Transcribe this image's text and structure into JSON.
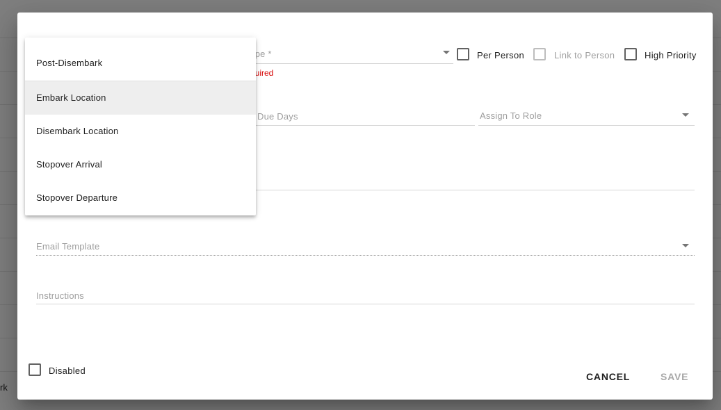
{
  "background": {
    "partial_text": "rk"
  },
  "dialog": {
    "type_field": {
      "label": "ype *",
      "error": "quired"
    },
    "checkboxes": {
      "per_person": "Per Person",
      "link_to_person": "Link to Person",
      "high_priority": "High Priority"
    },
    "due_days": {
      "label": "Due Days"
    },
    "assign_to_role": {
      "label": "Assign To Role"
    },
    "email_template": {
      "label": "Email Template"
    },
    "instructions": {
      "label": "Instructions"
    },
    "disabled_checkbox": {
      "label": "Disabled"
    },
    "actions": {
      "cancel": "CANCEL",
      "save": "SAVE"
    },
    "dropdown": {
      "items": [
        {
          "label": "Post-Disembark"
        },
        {
          "label": "Embark Location"
        },
        {
          "label": "Disembark Location"
        },
        {
          "label": "Stopover Arrival"
        },
        {
          "label": "Stopover Departure"
        }
      ],
      "highlighted_index": 1
    }
  }
}
